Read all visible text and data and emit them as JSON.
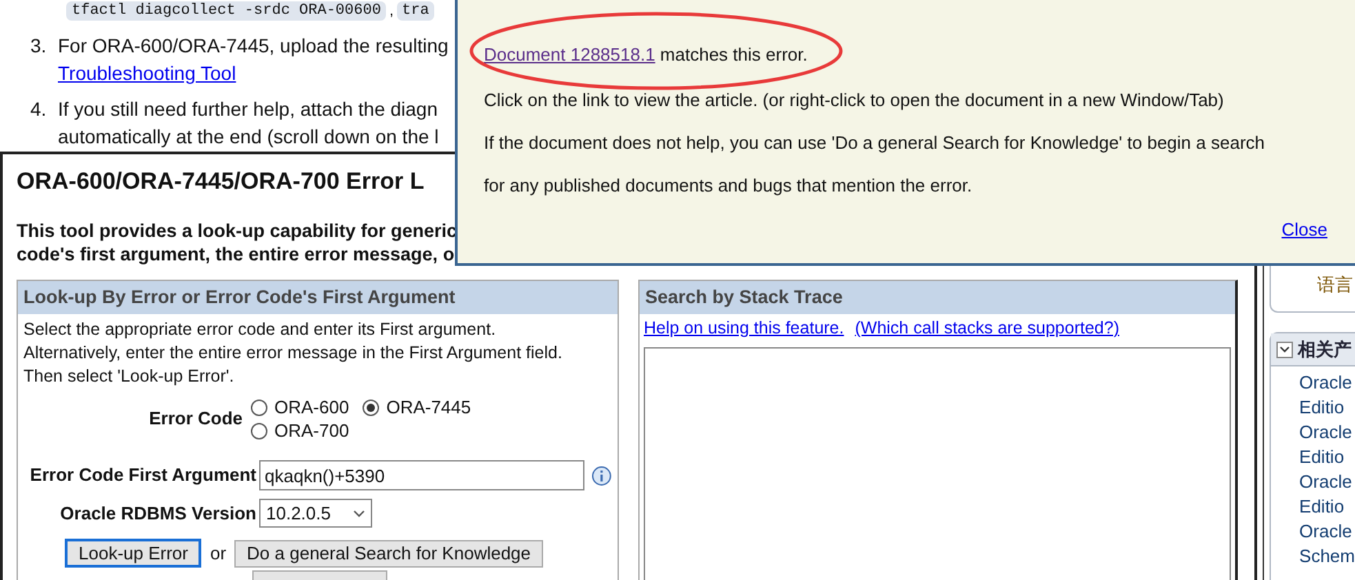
{
  "top_list": {
    "code_snippets": [
      "tfactl diagcollect -srdc ORA-00600",
      "tra"
    ],
    "separator": ",",
    "items": [
      {
        "number": "3.",
        "lines": [
          "For ORA-600/ORA-7445, upload the resulting"
        ],
        "link": "Troubleshooting Tool"
      },
      {
        "number": "4.",
        "lines": [
          "If you still need further help, attach the diagn",
          "automatically at the end (scroll down on the l"
        ]
      }
    ]
  },
  "tool": {
    "title": "ORA-600/ORA-7445/ORA-700 Error L",
    "description_lines": [
      "This tool provides a look-up capability for generic",
      "code's first argument, the entire error message, o"
    ]
  },
  "lookup": {
    "header": "Look-up By Error or Error Code's First Argument",
    "instructions": "Select the appropriate error code and enter its First argument.\nAlternatively, enter the entire error message in the First Argument field.\nThen select 'Look-up Error'.",
    "error_code": {
      "label": "Error Code",
      "options": [
        {
          "label": "ORA-600",
          "selected": false
        },
        {
          "label": "ORA-7445",
          "selected": true
        },
        {
          "label": "ORA-700",
          "selected": false
        }
      ]
    },
    "first_argument": {
      "label": "Error Code First Argument",
      "value": "qkaqkn()+5390"
    },
    "version": {
      "label": "Oracle RDBMS Version",
      "value": "10.2.0.5"
    },
    "lookup_button": {
      "label": "Look-up Error",
      "focused": true
    },
    "or": "or",
    "search_button": {
      "label": "Do a general Search for Knowledge"
    }
  },
  "stack_trace": {
    "header": "Search by Stack Trace",
    "links": [
      "Help on using this feature.",
      "(Which call stacks are supported?)"
    ]
  },
  "popup": {
    "link": "Document 1288518.1",
    "link_suffix": " matches this error.",
    "lines": [
      "Click on the link to view the article. (or right-click to open the document in a new Window/Tab)",
      "If the document does not help, you can use 'Do a general Search for Knowledge' to begin a search",
      "for any published documents and bugs that mention the error."
    ],
    "close": "Close"
  },
  "sidebar": {
    "language_label": "语言",
    "related_header": "相关产",
    "related_items": [
      "Oracle",
      "Editio",
      "Oracle",
      "Editio",
      "Oracle",
      "Editio",
      "Oracle",
      "Schem"
    ]
  }
}
